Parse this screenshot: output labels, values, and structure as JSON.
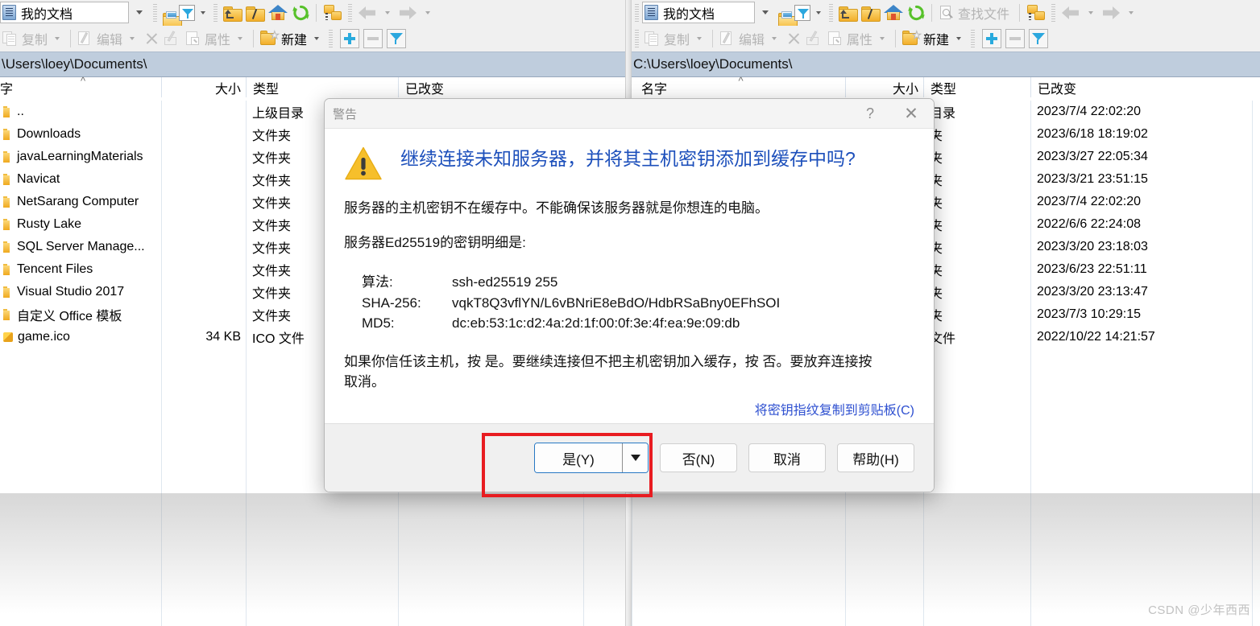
{
  "left_panel": {
    "toolbar": {
      "combo_value": "我的文档",
      "buttons": [
        {
          "name": "open-folder",
          "label": "",
          "icon": "folder-open-icon"
        },
        {
          "name": "filter",
          "label": "",
          "icon": "funnel-icon"
        },
        {
          "name": "parent-folder",
          "label": "",
          "icon": "folder-up-icon"
        },
        {
          "name": "root-folder",
          "label": "",
          "icon": "folder-backslash-icon"
        },
        {
          "name": "home-folder",
          "label": "",
          "icon": "home-icon"
        },
        {
          "name": "refresh",
          "label": "",
          "icon": "refresh-icon"
        },
        {
          "name": "copy-path",
          "label": "",
          "icon": "folder-copy-icon"
        }
      ]
    },
    "toolbar2": {
      "copy_label": "复制",
      "edit_label": "编辑",
      "properties_label": "属性",
      "new_label": "新建"
    },
    "path": "\\Users\\loey\\Documents\\",
    "columns": [
      "字",
      "大小",
      "类型",
      "已改变"
    ],
    "rows": [
      {
        "name": "..",
        "size": "",
        "type": "上级目录",
        "modified": "",
        "icon": "folder-icon"
      },
      {
        "name": "Downloads",
        "size": "",
        "type": "文件夹",
        "modified": "",
        "icon": "folder-icon"
      },
      {
        "name": "javaLearningMaterials",
        "size": "",
        "type": "文件夹",
        "modified": "",
        "icon": "folder-icon"
      },
      {
        "name": "Navicat",
        "size": "",
        "type": "文件夹",
        "modified": "",
        "icon": "folder-icon"
      },
      {
        "name": "NetSarang Computer",
        "size": "",
        "type": "文件夹",
        "modified": "",
        "icon": "folder-icon"
      },
      {
        "name": "Rusty Lake",
        "size": "",
        "type": "文件夹",
        "modified": "",
        "icon": "folder-icon"
      },
      {
        "name": "SQL Server Manage...",
        "size": "",
        "type": "文件夹",
        "modified": "",
        "icon": "folder-icon"
      },
      {
        "name": "Tencent Files",
        "size": "",
        "type": "文件夹",
        "modified": "",
        "icon": "folder-icon"
      },
      {
        "name": "Visual Studio 2017",
        "size": "",
        "type": "文件夹",
        "modified": "",
        "icon": "folder-icon"
      },
      {
        "name": "自定义 Office 模板",
        "size": "",
        "type": "文件夹",
        "modified": "",
        "icon": "folder-icon"
      },
      {
        "name": "game.ico",
        "size": "34 KB",
        "type": "ICO 文件",
        "modified": "",
        "icon": "ico-file-icon"
      }
    ]
  },
  "right_panel": {
    "toolbar": {
      "combo_value": "我的文档",
      "find_files_label": "查找文件"
    },
    "toolbar2": {
      "copy_label": "复制",
      "edit_label": "编辑",
      "properties_label": "属性",
      "new_label": "新建"
    },
    "path": "C:\\Users\\loey\\Documents\\",
    "columns": [
      "名字",
      "大小",
      "类型",
      "已改变"
    ],
    "rows": [
      {
        "name": "",
        "size": "",
        "type": "目录",
        "modified": "2023/7/4 22:02:20"
      },
      {
        "name": "",
        "size": "",
        "type": "夹",
        "modified": "2023/6/18 18:19:02"
      },
      {
        "name": "",
        "size": "",
        "type": "夹",
        "modified": "2023/3/27 22:05:34"
      },
      {
        "name": "",
        "size": "",
        "type": "夹",
        "modified": "2023/3/21 23:51:15"
      },
      {
        "name": "",
        "size": "",
        "type": "夹",
        "modified": "2023/7/4 22:02:20"
      },
      {
        "name": "",
        "size": "",
        "type": "夹",
        "modified": "2022/6/6 22:24:08"
      },
      {
        "name": "",
        "size": "",
        "type": "夹",
        "modified": "2023/3/20 23:18:03"
      },
      {
        "name": "",
        "size": "",
        "type": "夹",
        "modified": "2023/6/23 22:51:11"
      },
      {
        "name": "",
        "size": "",
        "type": "夹",
        "modified": "2023/3/20 23:13:47"
      },
      {
        "name": "",
        "size": "",
        "type": "夹",
        "modified": "2023/7/3 10:29:15"
      },
      {
        "name": "",
        "size": "",
        "type": "文件",
        "modified": "2022/10/22 14:21:57"
      }
    ]
  },
  "dialog": {
    "title": "警告",
    "help_glyph": "?",
    "close_glyph": "✕",
    "heading": "继续连接未知服务器，并将其主机密钥添加到缓存中吗?",
    "paragraph1": "服务器的主机密钥不在缓存中。不能确保该服务器就是你想连的电脑。",
    "paragraph2": "服务器Ed25519的密钥明细是:",
    "details": [
      {
        "key": "算法:",
        "value": "ssh-ed25519 255"
      },
      {
        "key": "SHA-256:",
        "value": "vqkT8Q3vflYN/L6vBNriE8eBdO/HdbRSaBny0EFhSOI"
      },
      {
        "key": "MD5:",
        "value": "dc:eb:53:1c:d2:4a:2d:1f:00:0f:3e:4f:ea:9e:09:db"
      }
    ],
    "note": "如果你信任该主机，按 是。要继续连接但不把主机密钥加入缓存，按 否。要放弃连接按 取消。",
    "copy_link": "将密钥指纹复制到剪贴板(C)",
    "buttons": {
      "yes": "是(Y)",
      "no": "否(N)",
      "cancel": "取消",
      "help": "帮助(H)"
    }
  },
  "annotation": {
    "highlight_color": "#e81c21"
  },
  "watermark": "CSDN @少年西西"
}
